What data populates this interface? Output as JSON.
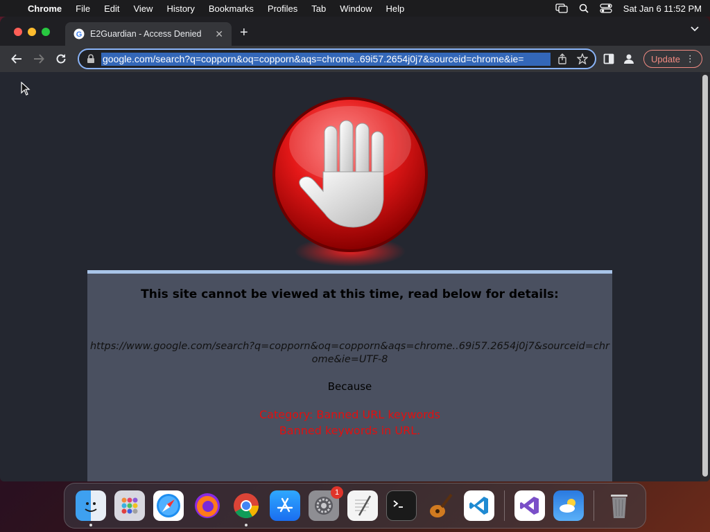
{
  "menubar": {
    "app_name": "Chrome",
    "items": [
      "File",
      "Edit",
      "View",
      "History",
      "Bookmarks",
      "Profiles",
      "Tab",
      "Window",
      "Help"
    ],
    "clock": "Sat Jan 6  11:52 PM"
  },
  "browser": {
    "tab_title": "E2Guardian - Access Denied",
    "address": "google.com/search?q=copporn&oq=copporn&aqs=chrome..69i57.2654j0j7&sourceid=chrome&ie=",
    "update_label": "Update"
  },
  "page": {
    "heading": "This site cannot be viewed at this time, read below for details:",
    "blocked_url": "https://www.google.com/search?q=copporn&oq=copporn&aqs=chrome..69i57.2654j0j7&sourceid=chrome&ie=UTF-8",
    "because_label": "Because",
    "category": "Category: Banned URL keywords",
    "reason": "Banned keywords in URL."
  },
  "dock": {
    "items": [
      "Finder",
      "Launchpad",
      "Safari",
      "Firefox",
      "Chrome",
      "App Store",
      "System Settings",
      "TextEdit",
      "Terminal",
      "GarageBand",
      "Visual Studio Code",
      "Visual Studio",
      "Weather",
      "Trash"
    ],
    "settings_badge": "1"
  },
  "colors": {
    "accent": "#8ab4f8",
    "reason_red": "#e01010",
    "panel_bg": "#4a5060"
  }
}
